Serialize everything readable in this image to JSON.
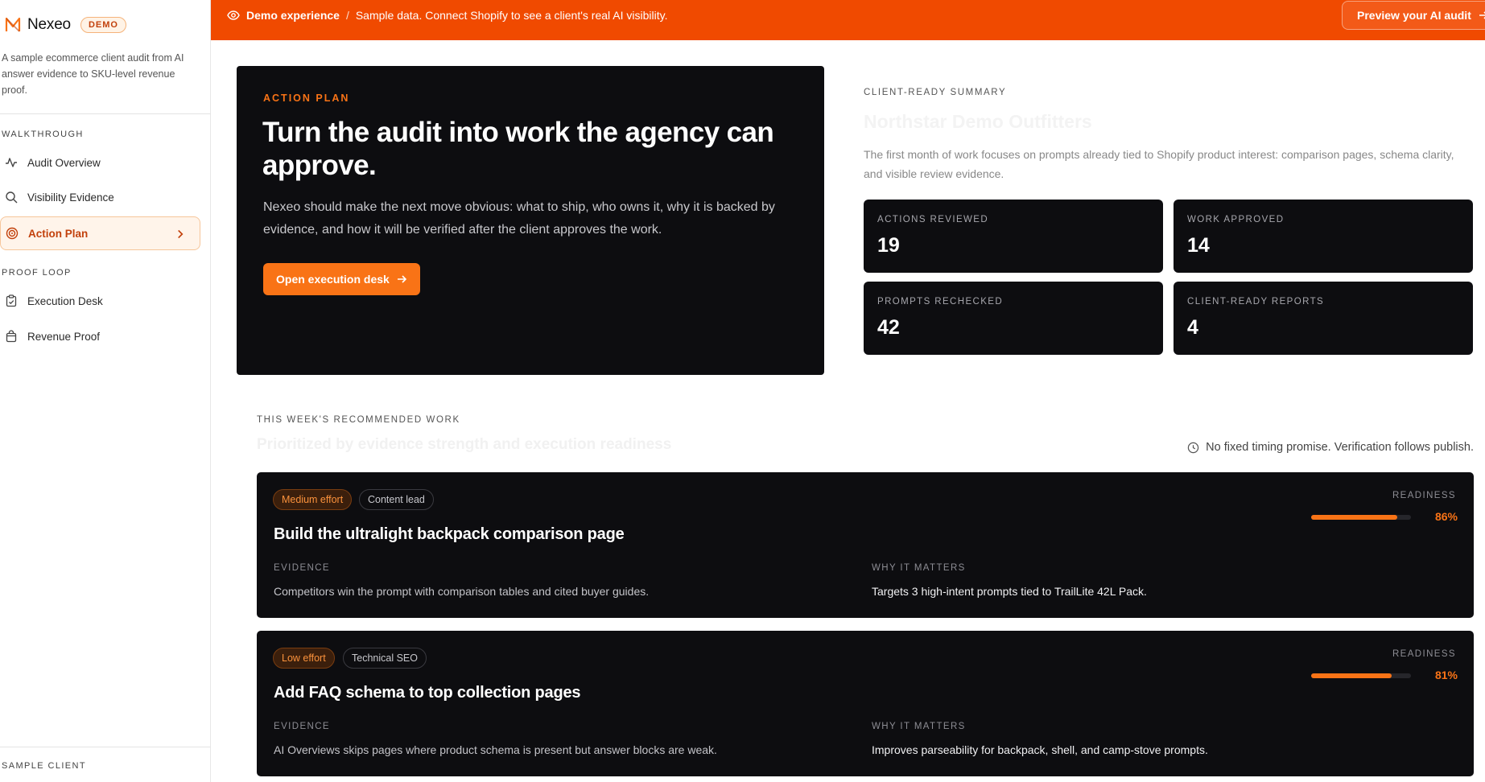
{
  "brand": {
    "name": "Nexeo",
    "badge": "DEMO"
  },
  "sidebar": {
    "description": "A sample ecommerce client audit from AI answer evidence to SKU-level revenue proof.",
    "sections": [
      {
        "label": "WALKTHROUGH",
        "items": [
          {
            "label": "Audit Overview",
            "icon": "activity-icon"
          },
          {
            "label": "Visibility Evidence",
            "icon": "search-icon"
          },
          {
            "label": "Action Plan",
            "icon": "target-icon",
            "active": true
          }
        ]
      },
      {
        "label": "PROOF LOOP",
        "items": [
          {
            "label": "Execution Desk",
            "icon": "clipboard-icon"
          },
          {
            "label": "Revenue Proof",
            "icon": "shopping-bag-icon"
          }
        ]
      }
    ],
    "footer_label": "SAMPLE CLIENT"
  },
  "banner": {
    "strong": "Demo experience",
    "separator": "/",
    "text": "Sample data. Connect Shopify to see a client's real AI visibility.",
    "cta": "Preview your AI audit"
  },
  "hero": {
    "kicker": "ACTION PLAN",
    "title": "Turn the audit into work the agency can approve.",
    "description": "Nexeo should make the next move obvious: what to ship, who owns it, why it is backed by evidence, and how it will be verified after the client approves the work.",
    "button": "Open execution desk"
  },
  "summary": {
    "kicker": "CLIENT-READY SUMMARY",
    "title": "Northstar Demo Outfitters",
    "description": "The first month of work focuses on prompts already tied to Shopify product interest: comparison pages, schema clarity, and visible review evidence.",
    "metrics": [
      {
        "label": "ACTIONS REVIEWED",
        "value": "19"
      },
      {
        "label": "WORK APPROVED",
        "value": "14"
      },
      {
        "label": "PROMPTS RECHECKED",
        "value": "42"
      },
      {
        "label": "CLIENT-READY REPORTS",
        "value": "4"
      }
    ]
  },
  "recommended": {
    "kicker": "THIS WEEK'S RECOMMENDED WORK",
    "subtitle": "Prioritized by evidence strength and execution readiness",
    "note": "No fixed timing promise. Verification follows publish.",
    "cards": [
      {
        "effort": "Medium effort",
        "owner": "Content lead",
        "title": "Build the ultralight backpack comparison page",
        "evidence_label": "EVIDENCE",
        "evidence": "Competitors win the prompt with comparison tables and cited buyer guides.",
        "why_label": "WHY IT MATTERS",
        "why": "Targets 3 high-intent prompts tied to TrailLite 42L Pack.",
        "readiness_label": "READINESS",
        "readiness": 0.86,
        "readiness_text": "86%"
      },
      {
        "effort": "Low effort",
        "owner": "Technical SEO",
        "title": "Add FAQ schema to top collection pages",
        "evidence_label": "EVIDENCE",
        "evidence": "AI Overviews skips pages where product schema is present but answer blocks are weak.",
        "why_label": "WHY IT MATTERS",
        "why": "Improves parseability for backpack, shell, and camp-stove prompts.",
        "readiness_label": "READINESS",
        "readiness": 0.81,
        "readiness_text": "81%"
      }
    ]
  },
  "colors": {
    "accent": "#f97316",
    "banner": "#f04a00",
    "card": "#0d0d10"
  }
}
